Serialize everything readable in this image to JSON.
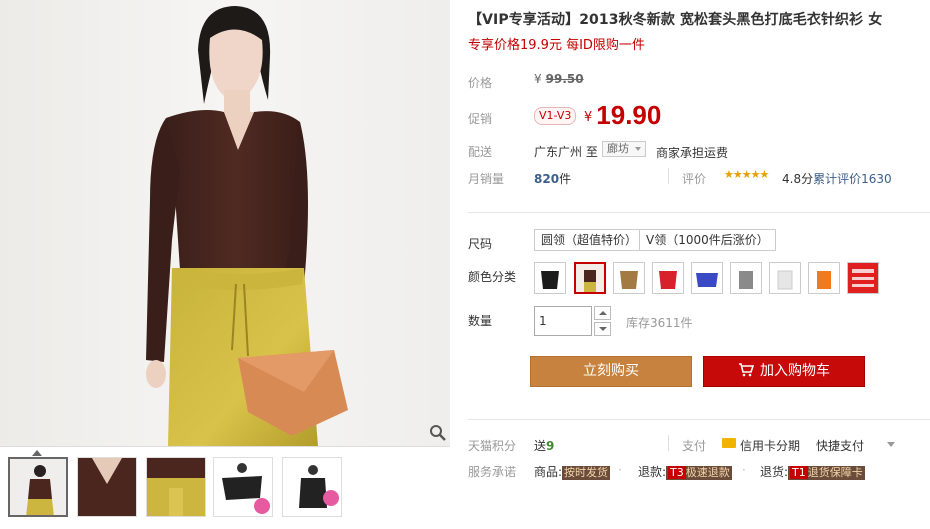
{
  "product": {
    "title": "【VIP专享活动】2013秋冬新款 宽松套头黑色打底毛衣针织衫 女",
    "subtitle": "专享价格19.9元 每ID限购一件"
  },
  "price": {
    "label": "价格",
    "currency": "¥",
    "original": "99.50"
  },
  "promo": {
    "label": "促销",
    "badge": "V1-V3",
    "currency": "¥",
    "price": "19.90"
  },
  "shipping": {
    "label": "配送",
    "from": "广东广州 至",
    "to": "廊坊",
    "fee": "商家承担运费"
  },
  "sales": {
    "label": "月销量",
    "count": "820",
    "unit": "件",
    "review_label": "评价",
    "stars": "★★★★★",
    "score": "4.8分",
    "review_link": "累计评价1630"
  },
  "size": {
    "label": "尺码",
    "options": [
      "圆领（超值特价）",
      "V领（1000件后涨价）"
    ]
  },
  "color": {
    "label": "颜色分类",
    "swatches": [
      "black",
      "brown",
      "camel",
      "red",
      "blue",
      "grey",
      "white",
      "orange",
      "red-print"
    ]
  },
  "quantity": {
    "label": "数量",
    "value": "1",
    "stock": "库存3611件"
  },
  "actions": {
    "buy": "立刻购买",
    "cart": "加入购物车"
  },
  "points": {
    "label": "天猫积分",
    "text": "送",
    "value": "9",
    "pay_label": "支付",
    "card": "信用卡分期",
    "quick": "快捷支付"
  },
  "services": {
    "label": "服务承诺",
    "items": [
      {
        "prefix": "商品:",
        "tag": "按时发货"
      },
      {
        "prefix": "退款:",
        "code": "T3",
        "tag": "极速退款"
      },
      {
        "prefix": "退货:",
        "code": "T1",
        "tag": "退货保障卡"
      }
    ]
  },
  "colors": {
    "accent_red": "#c40000",
    "buy_button": "#c6823e",
    "cart_button": "#c60a0a",
    "link_blue": "#3b5f8a"
  }
}
